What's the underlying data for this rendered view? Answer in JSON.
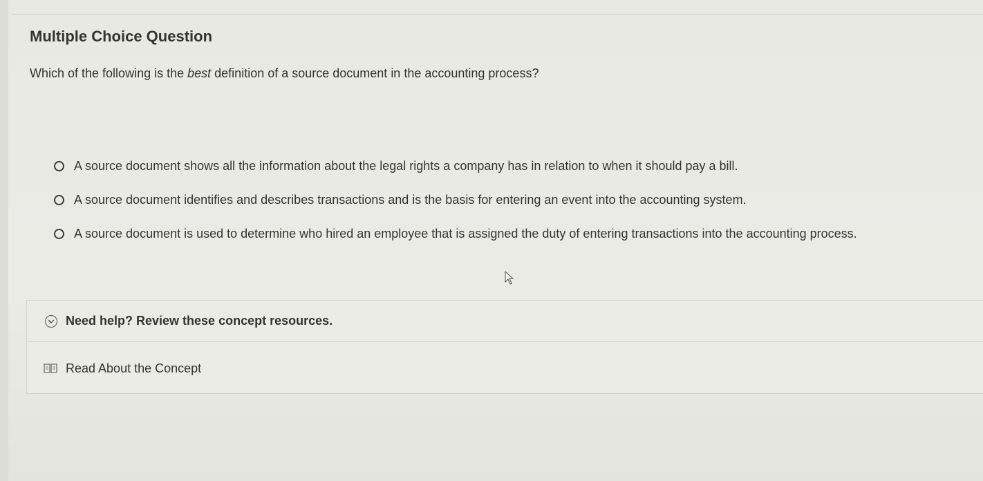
{
  "question": {
    "type_label": "Multiple Choice Question",
    "prompt_before": "Which of the following is the ",
    "prompt_emphasis": "best",
    "prompt_after": " definition of a source document in the accounting process?"
  },
  "options": [
    {
      "label": "A source document shows all the information about the legal rights a company has in relation to when it should pay a bill.",
      "selected": false
    },
    {
      "label": "A source document identifies and describes transactions and is the basis for entering an event into the accounting system.",
      "selected": false
    },
    {
      "label": "A source document is used to determine who hired an employee that is assigned the duty of entering transactions into the accounting process.",
      "selected": false
    }
  ],
  "help": {
    "toggle_label": "Need help? Review these concept resources.",
    "toggle_icon": "chevron-down-circle-icon",
    "resources": [
      {
        "label": "Read About the Concept",
        "icon": "book-icon"
      }
    ]
  }
}
